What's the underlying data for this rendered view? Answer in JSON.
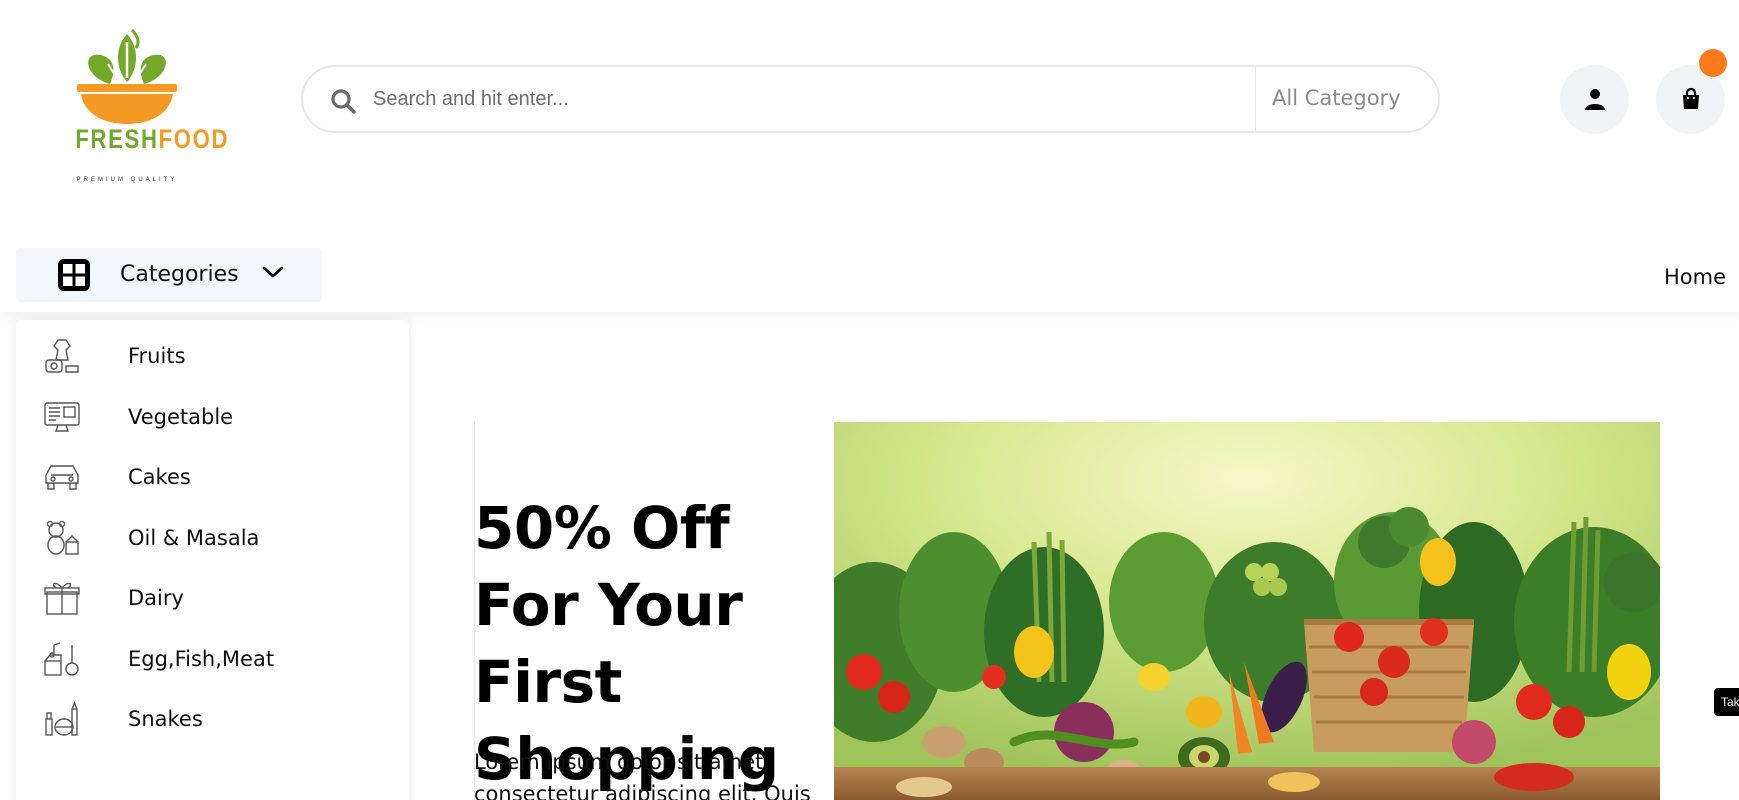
{
  "brand": {
    "word_part1": "FRESH",
    "word_part2": "FOOD",
    "tagline": "PREMIUM QUALITY",
    "green": "#73a82b",
    "orange": "#f39a25"
  },
  "header": {
    "search": {
      "placeholder": "Search and hit enter...",
      "icon": "search-icon",
      "category_label": "All Category"
    },
    "account_icon": "user-icon",
    "cart_icon": "shopping-bag-icon",
    "cart_badge_color": "#ff7a1a"
  },
  "nav": {
    "categories_label": "Categories",
    "categories_icon": "grid-icon",
    "chevron_icon": "chevron-down-icon",
    "home_label": "Home"
  },
  "categories": [
    {
      "label": "Fruits",
      "icon": "dress-icon"
    },
    {
      "label": "Vegetable",
      "icon": "monitor-icon"
    },
    {
      "label": "Cakes",
      "icon": "car-icon"
    },
    {
      "label": "Oil & Masala",
      "icon": "teddy-bear-icon"
    },
    {
      "label": "Dairy",
      "icon": "gift-box-icon"
    },
    {
      "label": "Egg,Fish,Meat",
      "icon": "music-instruments-icon"
    },
    {
      "label": "Snakes",
      "icon": "cosmetics-icon"
    }
  ],
  "hero": {
    "title": "50% Off For Your First Shopping",
    "text": "Lorem ipsum dolor sit amet, consectetur adipiscing elit. Quis",
    "image": "vegetables-banner-image"
  },
  "side_tab": {
    "label": "Tak"
  }
}
